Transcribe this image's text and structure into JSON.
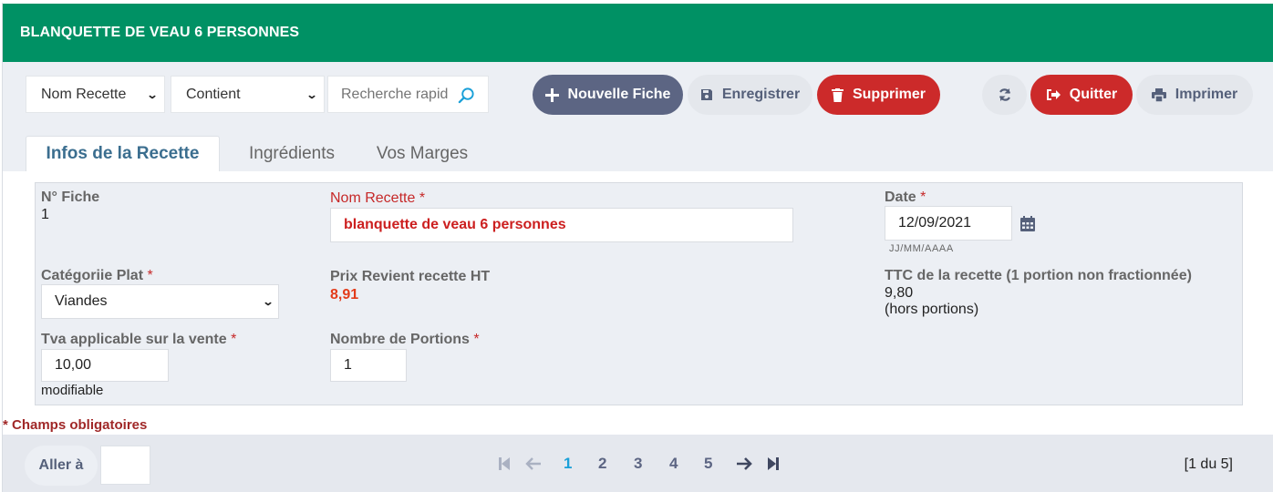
{
  "window": {
    "title": "BLANQUETTE DE VEAU 6 PERSONNES"
  },
  "toolbar": {
    "field_select": "Nom Recette",
    "operator_select": "Contient",
    "search_placeholder": "Recherche rapide",
    "new_label": "Nouvelle Fiche",
    "save_label": "Enregistrer",
    "delete_label": "Supprimer",
    "quit_label": "Quitter",
    "print_label": "Imprimer"
  },
  "tabs": [
    {
      "label": "Infos de la Recette",
      "active": true
    },
    {
      "label": "Ingrédients",
      "active": false
    },
    {
      "label": "Vos Marges",
      "active": false
    }
  ],
  "form": {
    "fiche_label": "N° Fiche",
    "fiche_value": "1",
    "name_label": "Nom Recette",
    "name_value": "blanquette de veau 6 personnes",
    "date_label": "Date",
    "date_value": "12/09/2021",
    "date_hint": "JJ/MM/AAAA",
    "category_label": "Catégoriie Plat",
    "category_value": "Viandes",
    "cost_label": "Prix Revient recette HT",
    "cost_value": "8,91",
    "ttc_label": "TTC de la recette (1 portion non fractionnée)",
    "ttc_value": "9,80",
    "ttc_note": "(hors portions)",
    "tva_label": "Tva applicable sur la vente",
    "tva_value": "10,00",
    "tva_note": "modifiable",
    "portions_label": "Nombre de Portions",
    "portions_value": "1",
    "required_marker": "*"
  },
  "required_note": "* Champs obligatoires",
  "pagination": {
    "goto_label": "Aller à",
    "pages": [
      "1",
      "2",
      "3",
      "4",
      "5"
    ],
    "current_page": "1",
    "count_text": "[1 du 5]"
  },
  "colors": {
    "header_green": "#009164",
    "primary_button": "#5c6583",
    "danger_button": "#cc2a2a",
    "required_red": "#c62828",
    "cost_orange": "#e33b1a",
    "active_page": "#1aa0d8"
  }
}
